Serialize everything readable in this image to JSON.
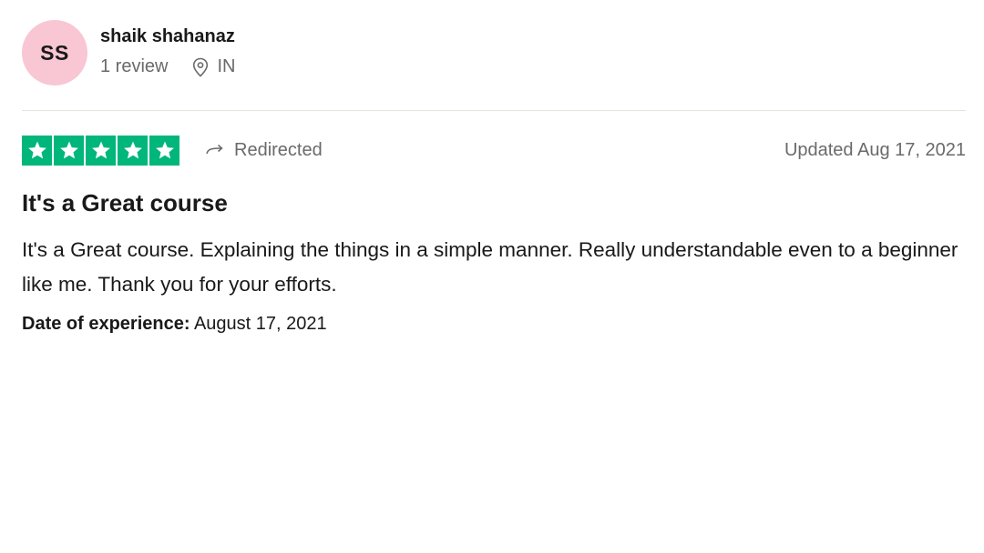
{
  "reviewer": {
    "initials": "SS",
    "name": "shaik shahanaz",
    "review_count": "1 review",
    "country": "IN",
    "avatar_color": "#f9c6d3"
  },
  "review": {
    "rating": 5,
    "rating_max": 5,
    "star_color": "#00b67a",
    "redirect_label": "Redirected",
    "updated": "Updated Aug 17, 2021",
    "title": "It's a Great course",
    "body": "It's a Great course. Explaining the things in a simple manner. Really understandable even to a beginner like me. Thank you for your efforts.",
    "experience_label": "Date of experience:",
    "experience_date": "August 17, 2021"
  },
  "icons": {
    "location": "location-pin-icon",
    "redirect": "redirect-arrow-icon",
    "star": "star-icon"
  }
}
